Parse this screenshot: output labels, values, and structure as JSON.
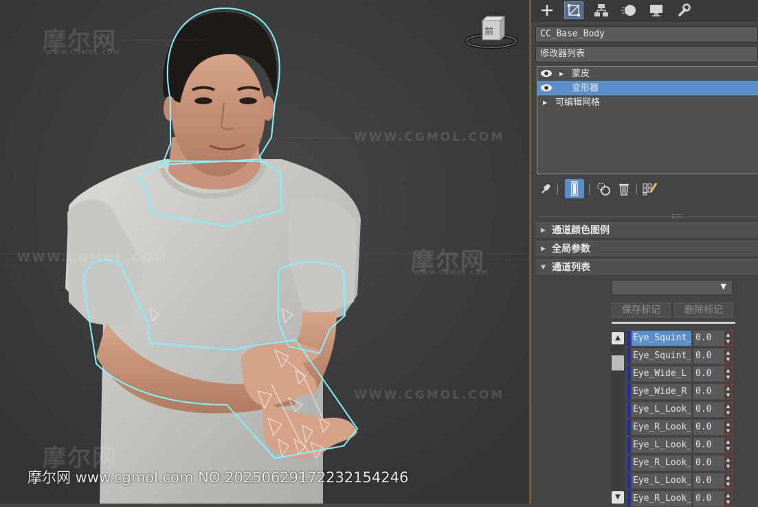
{
  "viewport": {
    "watermark_logo": "摩尔网",
    "watermark_domain": "WWW.CGMOL.COM",
    "viewcube_label": "前",
    "caption": "摩尔网 www.cgmol.com  NO:20250629172232154246"
  },
  "command_panel": {
    "tabs": [
      {
        "icon": "plus-icon"
      },
      {
        "icon": "modify-icon"
      },
      {
        "icon": "hierarchy-icon"
      },
      {
        "icon": "motion-icon"
      },
      {
        "icon": "display-icon"
      },
      {
        "icon": "utilities-icon"
      }
    ],
    "object_name": "CC_Base_Body",
    "modifier_list_label": "修改器列表",
    "stack": [
      {
        "label": "蒙皮",
        "visible": true,
        "expandable": true,
        "selected": false
      },
      {
        "label": "变形器",
        "visible": true,
        "expandable": false,
        "selected": true
      },
      {
        "label": "可编辑网格",
        "visible": false,
        "expandable": true,
        "selected": false
      }
    ],
    "stack_tools": [
      "pin-icon",
      "show-end-result-icon",
      "make-unique-icon",
      "remove-modifier-icon",
      "configure-icon"
    ]
  },
  "morpher": {
    "rollouts": [
      {
        "label": "通道颜色图例",
        "expanded": false
      },
      {
        "label": "全局参数",
        "expanded": false
      },
      {
        "label": "通道列表",
        "expanded": true
      }
    ],
    "marker_dropdown_value": "",
    "save_marker_label": "保存标记",
    "delete_marker_label": "删除标记",
    "channels": [
      {
        "name": "Eye_Squint_",
        "value": "0.0",
        "selected": true
      },
      {
        "name": "Eye_Squint_",
        "value": "0.0",
        "selected": false
      },
      {
        "name": "Eye_Wide_L",
        "value": "0.0",
        "selected": false
      },
      {
        "name": "Eye_Wide_R",
        "value": "0.0",
        "selected": false
      },
      {
        "name": "Eye_L_Look_",
        "value": "0.0",
        "selected": false
      },
      {
        "name": "Eye_R_Look_",
        "value": "0.0",
        "selected": false
      },
      {
        "name": "Eye_L_Look_",
        "value": "0.0",
        "selected": false
      },
      {
        "name": "Eye_R_Look_",
        "value": "0.0",
        "selected": false
      },
      {
        "name": "Eye_L_Look_",
        "value": "0.0",
        "selected": false
      },
      {
        "name": "Eye_R_Look_",
        "value": "0.0",
        "selected": false
      }
    ],
    "colors": {
      "channel_marker": "#1e2dbe",
      "selection": "#5b8fc9"
    }
  }
}
